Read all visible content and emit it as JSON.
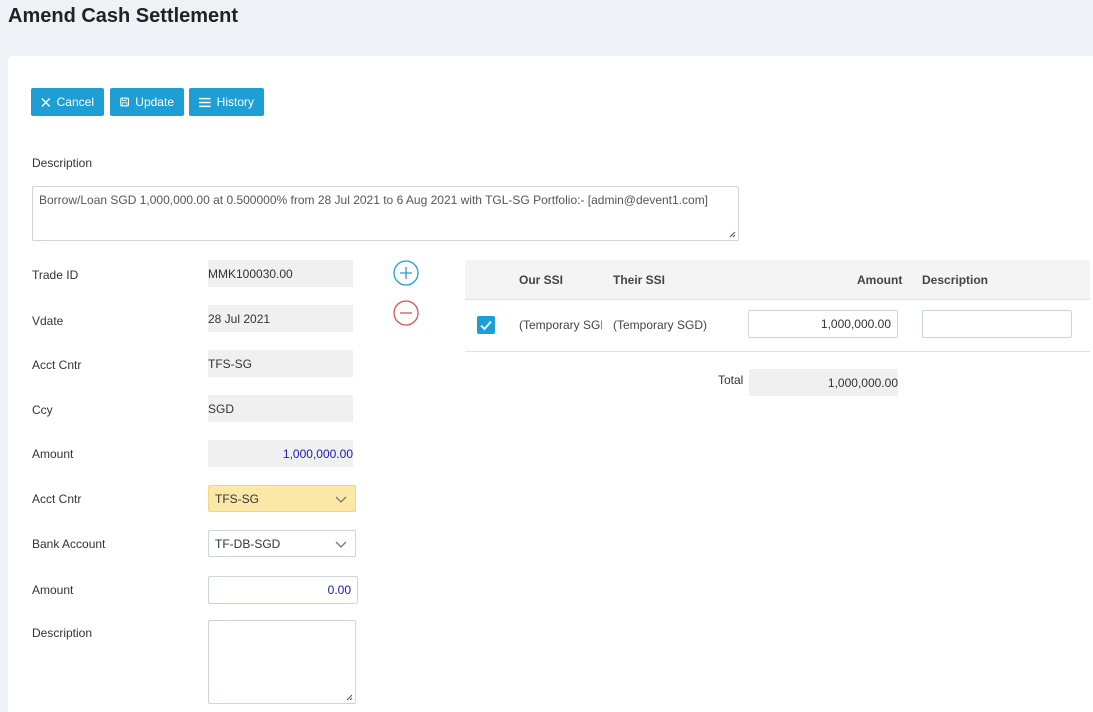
{
  "page": {
    "title": "Amend Cash Settlement"
  },
  "toolbar": {
    "cancel_label": "Cancel",
    "update_label": "Update",
    "history_label": "History"
  },
  "description": {
    "label": "Description",
    "value": "Borrow/Loan SGD 1,000,000.00 at 0.500000% from 28 Jul 2021 to 6 Aug 2021 with TGL-SG  Portfolio:- [admin@devent1.com]"
  },
  "form": {
    "trade_id": {
      "label": "Trade ID",
      "value": "MMK100030.00"
    },
    "vdate": {
      "label": "Vdate",
      "value": "28 Jul 2021"
    },
    "acct_cntr_ro": {
      "label": "Acct Cntr",
      "value": "TFS-SG"
    },
    "ccy": {
      "label": "Ccy",
      "value": "SGD"
    },
    "amount_ro": {
      "label": "Amount",
      "value": "1,000,000.00"
    },
    "acct_cntr_select": {
      "label": "Acct Cntr",
      "value": "TFS-SG"
    },
    "bank_account": {
      "label": "Bank Account",
      "value": "TF-DB-SGD"
    },
    "amount_input": {
      "label": "Amount",
      "value": "0.00"
    },
    "description": {
      "label": "Description",
      "value": ""
    }
  },
  "ssi_table": {
    "headers": {
      "our_ssi": "Our SSI",
      "their_ssi": "Their SSI",
      "amount": "Amount",
      "description": "Description"
    },
    "rows": [
      {
        "checked": true,
        "our_ssi": "(Temporary SGD)",
        "their_ssi": "(Temporary SGD)",
        "amount": "1,000,000.00",
        "description": ""
      }
    ],
    "total_label": "Total",
    "total_value": "1,000,000.00"
  },
  "colors": {
    "accent": "#1d9fd5",
    "add_icon": "#1d9fd5",
    "remove_icon": "#d9534f",
    "highlight_select": "#fbe8a6",
    "numeric_text": "#1a1ab0"
  }
}
